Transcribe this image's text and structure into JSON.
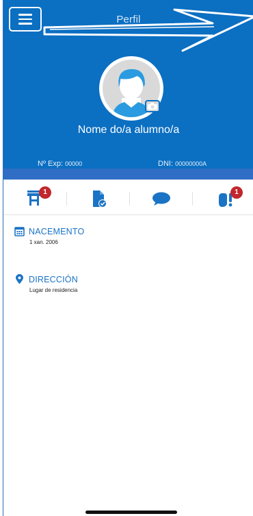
{
  "header": {
    "title": "Perfil",
    "student_name": "Nome do/a alumno/a",
    "exp_label": "Nº Exp:",
    "exp_value": "00000",
    "dni_label": "DNI:",
    "dni_value": "00000000A"
  },
  "icons": {
    "menu": "menu-icon",
    "avatar": "avatar-placeholder",
    "camera": "camera-icon",
    "classroom": "classroom-desk-icon",
    "document": "document-check-icon",
    "messages": "chat-bubble-icon",
    "alerts": "alert-hand-icon",
    "calendar": "calendar-icon",
    "location": "location-pin-icon"
  },
  "tabs": [
    {
      "name": "classroom",
      "badge": "1"
    },
    {
      "name": "documents",
      "badge": ""
    },
    {
      "name": "messages",
      "badge": ""
    },
    {
      "name": "alerts",
      "badge": "1"
    }
  ],
  "birth": {
    "title": "NACEMENTO",
    "value": "1 xan. 2006"
  },
  "address": {
    "title": "DIRECCIÓN",
    "value": "Lugar de residencia"
  },
  "colors": {
    "header_blue": "#0b6fc2",
    "accent_blue": "#1a73c5",
    "badge_red": "#c1272d"
  }
}
